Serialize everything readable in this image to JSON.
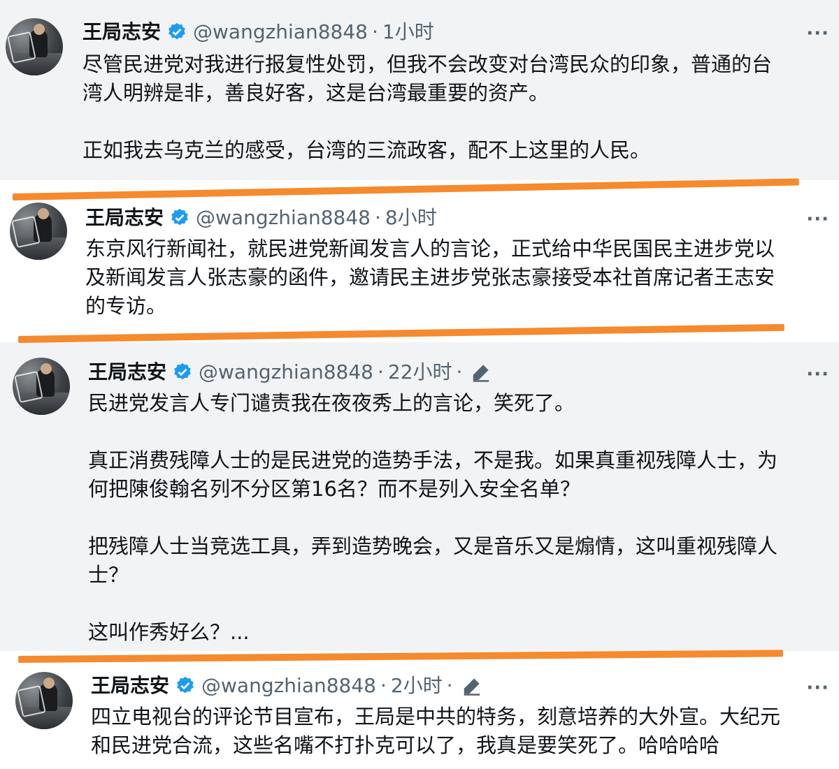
{
  "tweets": [
    {
      "name": "王局志安",
      "handle": "@wangzhian8848",
      "time": "1小时",
      "text": "尽管民进党对我进行报复性处罚，但我不会改变对台湾民众的印象，普通的台\n湾人明辨是非，善良好客，这是台湾最重要的资产。\n\n正如我去乌克兰的感受，台湾的三流政客，配不上这里的人民。"
    },
    {
      "name": "王局志安",
      "handle": "@wangzhian8848",
      "time": "8小时",
      "text": "东京风行新闻社，就民进党新闻发言人的言论，正式给中华民国民主进步党以\n及新闻发言人张志豪的函件，邀请民主进步党张志豪接受本社首席记者王志安\n的专访。"
    },
    {
      "name": "王局志安",
      "handle": "@wangzhian8848",
      "time": "22小时",
      "text": "民进党发言人专门谴责我在夜夜秀上的言论，笑死了。\n\n真正消费残障人士的是民进党的造势手法，不是我。如果真重视残障人士，为\n何把陳俊翰名列不分区第16名？而不是列入安全名单？\n\n把残障人士当竞选工具，弄到造势晚会，又是音乐又是煽情，这叫重视残障人\n士？\n\n这叫作秀好么？..."
    },
    {
      "name": "王局志安",
      "handle": "@wangzhian8848",
      "time": "2小时",
      "text": "四立电视台的评论节目宣布，王局是中共的特务，刻意培养的大外宣。大纪元\n和民进党合流，这些名嘴不打扑克可以了，我真是要笑死了。哈哈哈哈"
    }
  ],
  "separator": "·",
  "more_label": "···",
  "colors": {
    "verified": "#1d9bf0",
    "underline": "#f58a2e",
    "secondary_text": "#536471"
  },
  "icons": {
    "verified": "verified-badge-icon",
    "edit": "edit-pencil-icon",
    "more": "more-dots-icon"
  }
}
